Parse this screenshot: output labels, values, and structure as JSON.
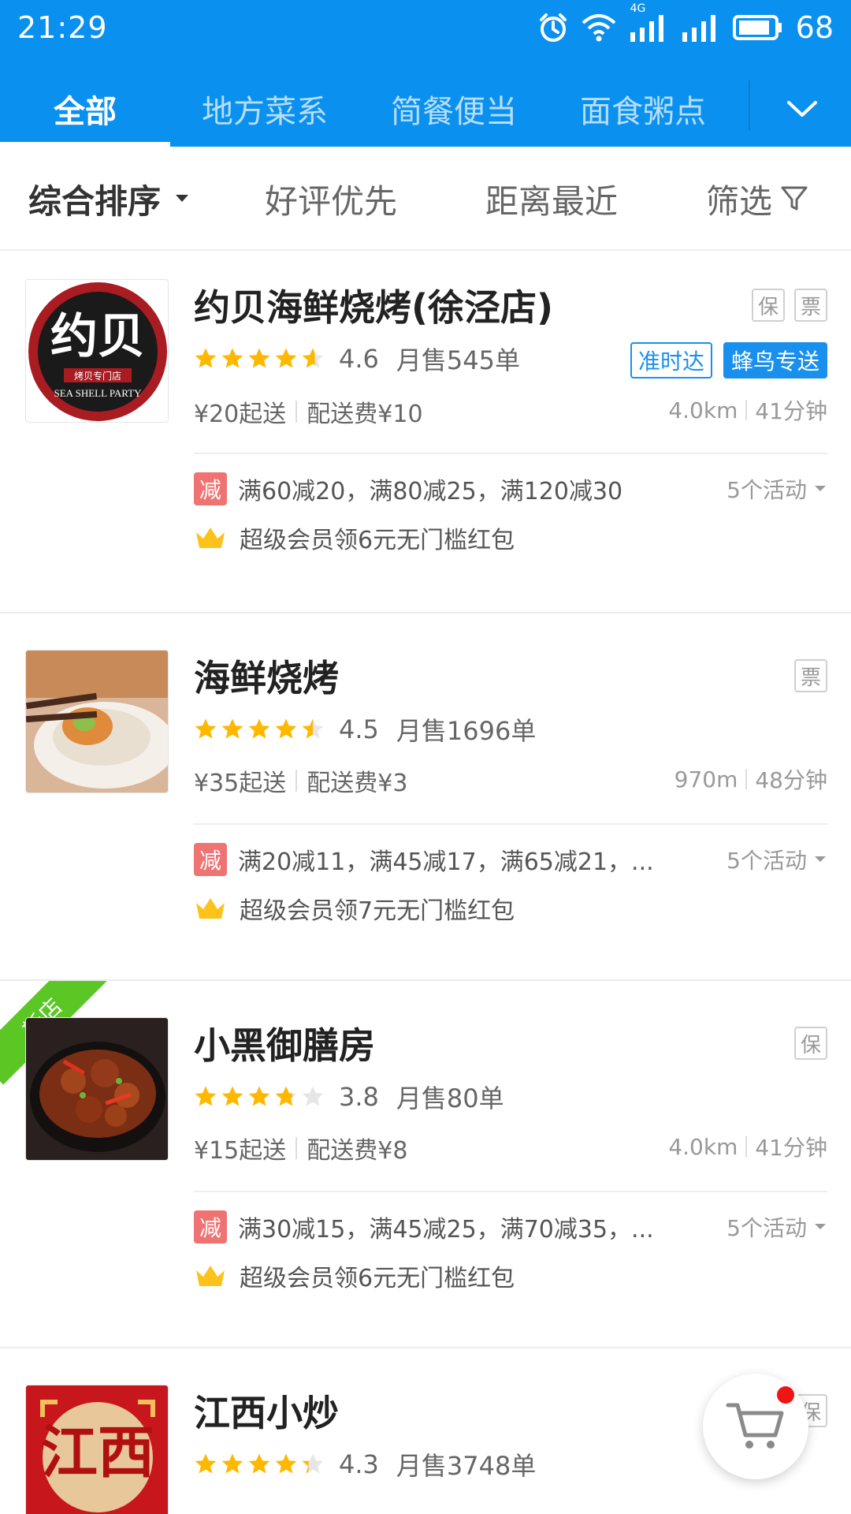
{
  "status_bar": {
    "time": "21:29",
    "network": "4G",
    "battery": "68"
  },
  "tabs": [
    {
      "label": "全部",
      "active": true
    },
    {
      "label": "地方菜系"
    },
    {
      "label": "简餐便当"
    },
    {
      "label": "面食粥点"
    }
  ],
  "sort_bar": {
    "comprehensive": "综合排序",
    "rating_first": "好评优先",
    "nearest": "距离最近",
    "filter": "筛选"
  },
  "stores": [
    {
      "name": "约贝海鲜烧烤(徐泾店)",
      "logo_text": "约贝",
      "logo_sub": "烤贝专门店",
      "logo_en": "SEA SHELL PARTY",
      "tags": [
        "保",
        "票"
      ],
      "delivery_tags": [
        "准时达",
        "蜂鸟专送"
      ],
      "rating": "4.6",
      "rating_value": 4.6,
      "monthly_sales": "月售545单",
      "min_order": "¥20起送",
      "delivery_fee": "配送费¥10",
      "distance": "4.0km",
      "eta": "41分钟",
      "promo_badge": "减",
      "promo": "满60减20，满80减25，满120减30",
      "activities": "5个活动",
      "vip": "超级会员领6元无门槛红包"
    },
    {
      "name": "海鲜烧烤",
      "tags": [
        "票"
      ],
      "rating": "4.5",
      "rating_value": 4.5,
      "monthly_sales": "月售1696单",
      "min_order": "¥35起送",
      "delivery_fee": "配送费¥3",
      "distance": "970m",
      "eta": "48分钟",
      "promo_badge": "减",
      "promo": "满20减11，满45减17，满65减21，...",
      "activities": "5个活动",
      "vip": "超级会员领7元无门槛红包"
    },
    {
      "name": "小黑御膳房",
      "new_label": "新店",
      "tags": [
        "保"
      ],
      "rating": "3.8",
      "rating_value": 3.8,
      "monthly_sales": "月售80单",
      "min_order": "¥15起送",
      "delivery_fee": "配送费¥8",
      "distance": "4.0km",
      "eta": "41分钟",
      "promo_badge": "减",
      "promo": "满30减15，满45减25，满70减35，...",
      "activities": "5个活动",
      "vip": "超级会员领6元无门槛红包"
    },
    {
      "name": "江西小炒",
      "logo_text": "江西",
      "tags": [
        "保"
      ],
      "rating": "4.3",
      "rating_value": 4.3,
      "monthly_sales": "月售3748单"
    }
  ],
  "colors": {
    "header": "#0a90ee",
    "brand_blue": "#1a90ee",
    "star": "#ffb800",
    "promo_red": "#f07373",
    "new_green": "#5ac725"
  }
}
